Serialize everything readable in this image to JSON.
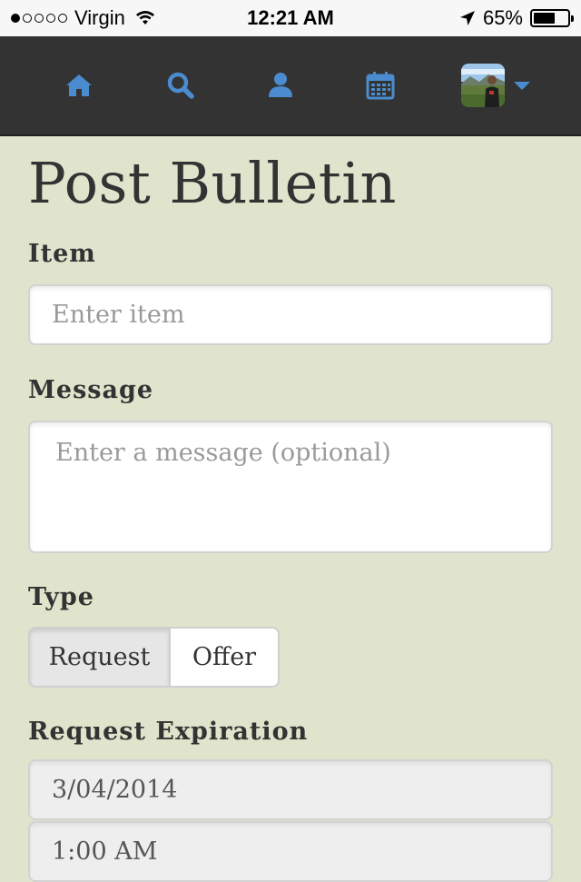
{
  "status_bar": {
    "carrier": "Virgin",
    "time": "12:21 AM",
    "battery_percent": "65%",
    "battery_level": 0.65,
    "signal_dots_filled": 1,
    "signal_dots_total": 5
  },
  "navbar": {
    "icons": [
      "home-icon",
      "search-icon",
      "user-icon",
      "calendar-icon"
    ],
    "accent_color": "#4a8ccf",
    "background": "#333333"
  },
  "form": {
    "title": "Post Bulletin",
    "item": {
      "label": "Item",
      "placeholder": "Enter item",
      "value": ""
    },
    "message": {
      "label": "Message",
      "placeholder": "Enter a message (optional)",
      "value": ""
    },
    "type": {
      "label": "Type",
      "options": [
        "Request",
        "Offer"
      ],
      "selected": "Request"
    },
    "expiration": {
      "label": "Request Expiration",
      "date": "3/04/2014",
      "time": "1:00 AM"
    }
  },
  "colors": {
    "page_background": "#e1e4cc",
    "text": "#333333"
  }
}
